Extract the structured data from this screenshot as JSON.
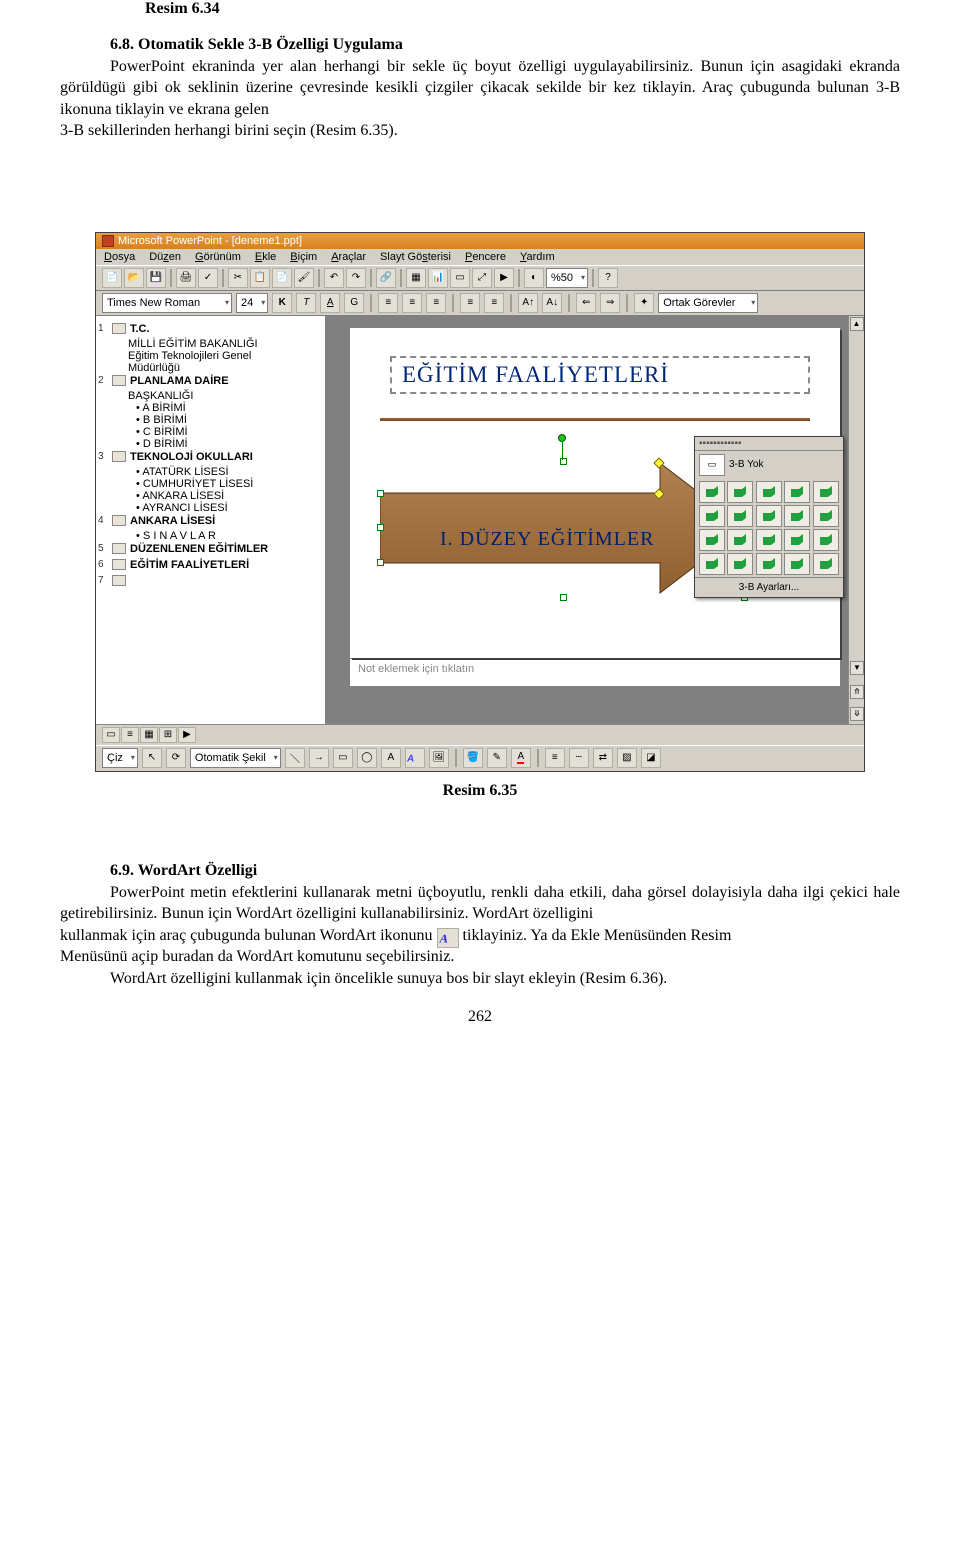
{
  "header_caption": "Resim 6.34",
  "section1": {
    "title": "6.8. Otomatik Sekle 3-B Özelligi Uygulama",
    "p1": "PowerPoint ekraninda yer alan herhangi bir sekle üç boyut özelligi uygulayabilirsiniz. Bunun için asagidaki ekranda görüldügü gibi ok seklinin üzerine çevresinde kesikli çizgiler çikacak sekilde bir kez tiklayin. Araç çubugunda bulunan 3-B ikonuna tiklayin ve ekrana gelen",
    "p2": "3-B sekillerinden herhangi birini seçin (Resim 6.35)."
  },
  "screenshot": {
    "title": "Microsoft PowerPoint - [deneme1.ppt]",
    "menus": [
      "Dosya",
      "Düzen",
      "Görünüm",
      "Ekle",
      "Biçim",
      "Araçlar",
      "Slayt Gösterisi",
      "Pencere",
      "Yardım"
    ],
    "font_name": "Times New Roman",
    "font_size": "24",
    "bold": "K",
    "italic": "T",
    "underline": "A",
    "shadow": "G",
    "zoom": "%50",
    "ortak": "Ortak Görevler",
    "outline": {
      "s1_head": "T.C.",
      "s1_l1": "MİLLİ EĞİTİM BAKANLIĞI",
      "s1_l2": "Eğitim Teknolojileri Genel",
      "s1_l3": "Müdürlüğü",
      "s2_head": "PLANLAMA DAİRE",
      "s2_head2": "BAŞKANLIĞI",
      "s2_a": "A BİRİMİ",
      "s2_b": "B BİRİMİ",
      "s2_c": "C BİRİMİ",
      "s2_d": "D BİRİMİ",
      "s3_head": "TEKNOLOJİ OKULLARI",
      "s3_a": "ATATÜRK LİSESİ",
      "s3_b": "CUMHURİYET LİSESİ",
      "s3_c": "ANKARA LİSESİ",
      "s3_d": "AYRANCI LİSESİ",
      "s4_head": "ANKARA  LİSESİ",
      "s4_a": "S I N A V L A R",
      "s5_head": "DÜZENLENEN EĞİTİMLER",
      "s6_head": "EĞİTİM FAALİYETLERİ"
    },
    "slide_title": "EĞİTİM FAALİYETLERİ",
    "arrow_text": "I. DÜZEY EĞİTİMLER",
    "popup_no3d": "3-B Yok",
    "popup_settings": "3-B Ayarları...",
    "notes": "Not eklemek için tıklatın",
    "draw_label": "Çiz",
    "autoshape_label": "Otomatik Şekil"
  },
  "caption2": "Resim 6.35",
  "section2": {
    "title": "6.9. WordArt Özelligi",
    "p1": "PowerPoint metin efektlerini kullanarak metni üçboyutlu, renkli daha etkili, daha görsel dolayisiyla daha ilgi çekici hale getirebilirsiniz. Bunun için WordArt özelligini kullanabilirsiniz. WordArt özelligini",
    "p2a": "kullanmak için araç çubugunda bulunan WordArt ikonunu",
    "p2b": "tiklayiniz. Ya da Ekle Menüsünden Resim",
    "p3": "Menüsünü açip buradan da WordArt komutunu seçebilirsiniz.",
    "p4": "WordArt özelligini kullanmak için öncelikle sunuya bos bir slayt ekleyin (Resim 6.36)."
  },
  "pageno": "262"
}
